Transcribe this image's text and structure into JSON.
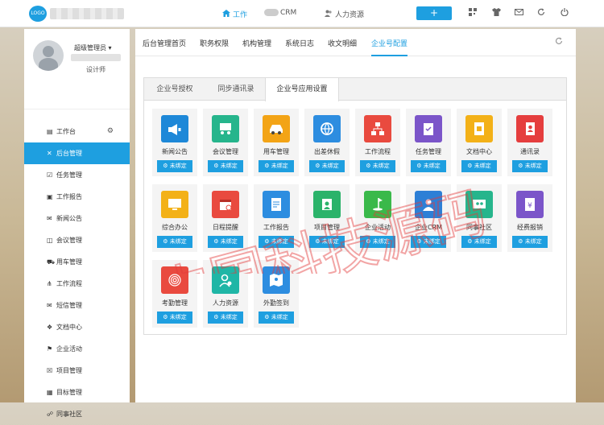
{
  "topbar": {
    "logo": "LOGO",
    "nav": [
      {
        "label": "工作",
        "icon": "home-icon"
      },
      {
        "label": "CRM",
        "icon": "toggle-icon"
      },
      {
        "label": "人力资源",
        "icon": "people-icon"
      }
    ],
    "add_label": "+",
    "icons": [
      "qrcode-icon",
      "shirt-icon",
      "mail-icon",
      "refresh-icon",
      "power-icon"
    ]
  },
  "sidebar": {
    "user_name": "超级管理员 ▾",
    "user_role": "设计师",
    "items": [
      {
        "label": "工作台",
        "icon": "▤"
      },
      {
        "label": "后台管理",
        "icon": "✕"
      },
      {
        "label": "任务管理",
        "icon": "☑"
      },
      {
        "label": "工作报告",
        "icon": "▣"
      },
      {
        "label": "新闻公告",
        "icon": "✉"
      },
      {
        "label": "会议管理",
        "icon": "◫"
      },
      {
        "label": "用车管理",
        "icon": "⛟"
      },
      {
        "label": "工作流程",
        "icon": "⋔"
      },
      {
        "label": "短信管理",
        "icon": "✉"
      },
      {
        "label": "文档中心",
        "icon": "❖"
      },
      {
        "label": "企业活动",
        "icon": "⚑"
      },
      {
        "label": "项目管理",
        "icon": "☒"
      },
      {
        "label": "目标管理",
        "icon": "▦"
      },
      {
        "label": "同事社区",
        "icon": "☍"
      }
    ]
  },
  "main": {
    "tabs": [
      "后台管理首页",
      "职务权限",
      "机构管理",
      "系统日志",
      "收文明细",
      "企业号配置"
    ],
    "panel_tabs": [
      "企业号授权",
      "同步通讯录",
      "企业号应用设置"
    ],
    "bind_label": "⚙ 未绑定",
    "apps": [
      {
        "label": "新闻公告",
        "color": "#1e88d8",
        "icon": "megaphone-icon"
      },
      {
        "label": "会议管理",
        "color": "#26b58c",
        "icon": "meeting-icon"
      },
      {
        "label": "用车管理",
        "color": "#f3a416",
        "icon": "car-icon"
      },
      {
        "label": "出差休假",
        "color": "#2d8de0",
        "icon": "globe-icon"
      },
      {
        "label": "工作流程",
        "color": "#e94a3f",
        "icon": "flow-icon"
      },
      {
        "label": "任务管理",
        "color": "#7b55c9",
        "icon": "clipboard-icon"
      },
      {
        "label": "文档中心",
        "color": "#f3b118",
        "icon": "document-icon"
      },
      {
        "label": "通讯录",
        "color": "#e53e3e",
        "icon": "contacts-icon"
      },
      {
        "label": "综合办公",
        "color": "#f3b118",
        "icon": "monitor-icon"
      },
      {
        "label": "日程提醒",
        "color": "#e94a3f",
        "icon": "calendar-icon"
      },
      {
        "label": "工作报告",
        "color": "#2d8de0",
        "icon": "report-icon"
      },
      {
        "label": "项目管理",
        "color": "#2bb36a",
        "icon": "project-icon"
      },
      {
        "label": "企业活动",
        "color": "#3ab94a",
        "icon": "golf-icon"
      },
      {
        "label": "企业CRM",
        "color": "#2d7fd6",
        "icon": "crm-icon"
      },
      {
        "label": "同事社区",
        "color": "#26b58c",
        "icon": "community-icon"
      },
      {
        "label": "经费报销",
        "color": "#7b55c9",
        "icon": "money-icon"
      },
      {
        "label": "考勤管理",
        "color": "#e94a3f",
        "icon": "fingerprint-icon"
      },
      {
        "label": "人力资源",
        "color": "#1fb6a6",
        "icon": "user-add-icon"
      },
      {
        "label": "外勤签到",
        "color": "#2d8de0",
        "icon": "map-icon"
      }
    ]
  },
  "watermark": "中国科技源码"
}
